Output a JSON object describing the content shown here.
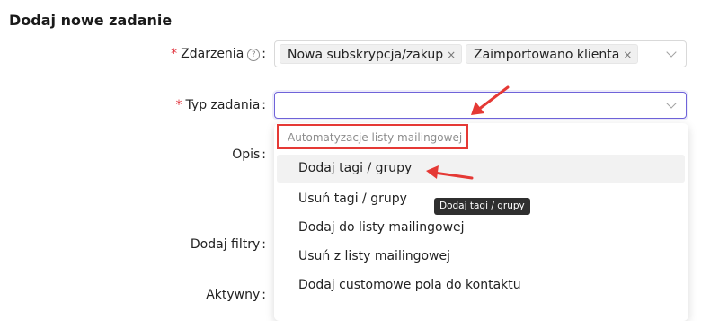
{
  "page": {
    "title": "Dodaj nowe zadanie"
  },
  "form": {
    "events": {
      "label": "Zdarzenia",
      "help_symbol": "?",
      "tags": [
        {
          "label": "Nowa subskrypcja/zakup",
          "remove_symbol": "×"
        },
        {
          "label": "Zaimportowano klienta",
          "remove_symbol": "×"
        }
      ]
    },
    "task_type": {
      "label": "Typ zadania",
      "value": ""
    },
    "description": {
      "label": "Opis"
    },
    "filters": {
      "label": "Dodaj filtry"
    },
    "active": {
      "label": "Aktywny"
    },
    "required_mark": "*",
    "colon": ":"
  },
  "dropdown": {
    "group_title": "Automatyzacje listy mailingowej",
    "options": [
      "Dodaj tagi / grupy",
      "Usuń tagi / grupy",
      "Dodaj do listy mailingowej",
      "Usuń z listy mailingowej",
      "Dodaj customowe pola do kontaktu"
    ],
    "active_index": 0
  },
  "tooltip": {
    "text": "Dodaj tagi / grupy"
  },
  "colors": {
    "accent": "#6f63d9",
    "annotation_red": "#e53935",
    "required": "#e0303a"
  }
}
